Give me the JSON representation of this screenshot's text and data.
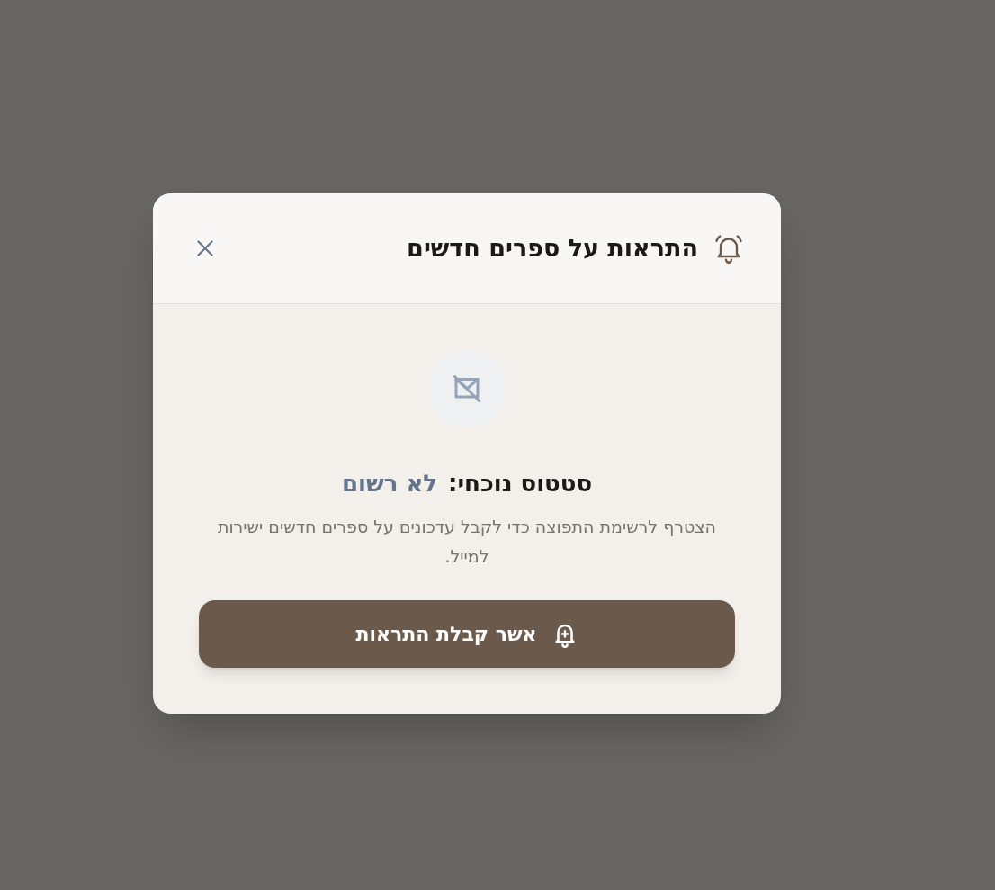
{
  "dialog": {
    "title": "התראות על ספרים חדשים",
    "status_label": "סטטוס נוכחי:",
    "status_value": "לא רשום",
    "description": "הצטרף לרשימת התפוצה כדי לקבל עדכונים על ספרים חדשים ישירות למייל.",
    "confirm_button": "אשר קבלת התראות"
  }
}
